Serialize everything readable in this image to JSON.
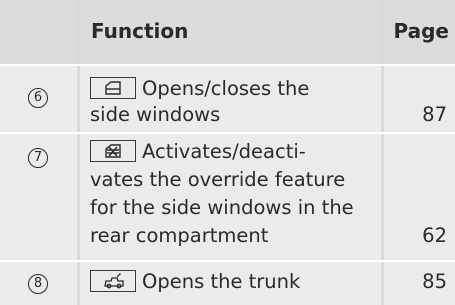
{
  "header": {
    "function_label": "Function",
    "page_label": "Page"
  },
  "rows": [
    {
      "number": "6",
      "icon": "side-window-icon",
      "lines": [
        "Opens/closes the",
        "side windows"
      ],
      "page": "87"
    },
    {
      "number": "7",
      "icon": "override-window-icon",
      "lines": [
        "Activates/deacti-",
        "vates the override feature",
        "for the side windows in the",
        "rear compartment"
      ],
      "page": "62"
    },
    {
      "number": "8",
      "icon": "trunk-icon",
      "lines": [
        "Opens the trunk"
      ],
      "page": "85"
    }
  ]
}
